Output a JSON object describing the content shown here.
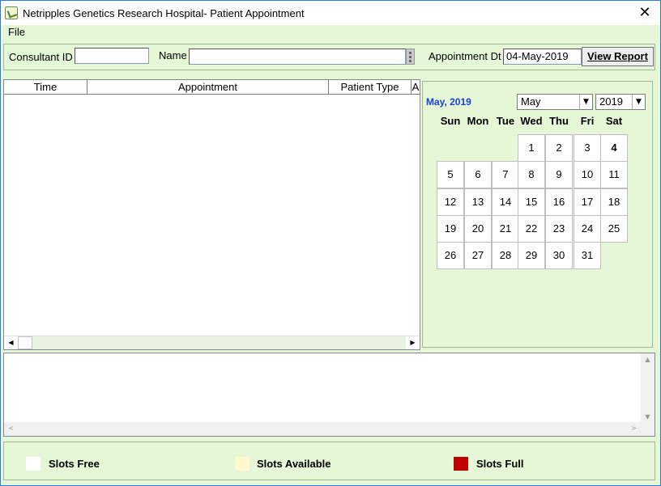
{
  "window": {
    "title": "Netripples Genetics Research Hospital- Patient Appointment",
    "close_glyph": "✕"
  },
  "menu": {
    "file": "File"
  },
  "filter": {
    "consultant_id_label": "Consultant ID",
    "consultant_id_value": "",
    "name_label": "Name",
    "name_value": "",
    "appt_dt_label": "Appointment Dt",
    "appt_dt_value": "04-May-2019",
    "view_report": "View Report"
  },
  "grid": {
    "columns": [
      "Time",
      "Appointment",
      "Patient Type",
      "A"
    ],
    "scroll_left": "◀",
    "scroll_right": "▶"
  },
  "calendar": {
    "title": "May, 2019",
    "month": "May",
    "year": "2019",
    "dropdown_glyph": "▼",
    "weekdays": [
      "Sun",
      "Mon",
      "Tue",
      "Wed",
      "Thu",
      "Fri",
      "Sat"
    ],
    "days": [
      "1",
      "2",
      "3",
      "4",
      "5",
      "6",
      "7",
      "8",
      "9",
      "10",
      "11",
      "12",
      "13",
      "14",
      "15",
      "16",
      "17",
      "18",
      "19",
      "20",
      "21",
      "22",
      "23",
      "24",
      "25",
      "26",
      "27",
      "28",
      "29",
      "30",
      "31"
    ],
    "selected_day": "4"
  },
  "info_scroll": {
    "up": "▲",
    "down": "▼",
    "left": "<",
    "right": ">"
  },
  "legend": {
    "items": [
      {
        "label": "Slots Free",
        "color": "#ffffff"
      },
      {
        "label": "Slots Available",
        "color": "#fff9d0"
      },
      {
        "label": "Slots Full",
        "color": "#c00000"
      }
    ]
  }
}
